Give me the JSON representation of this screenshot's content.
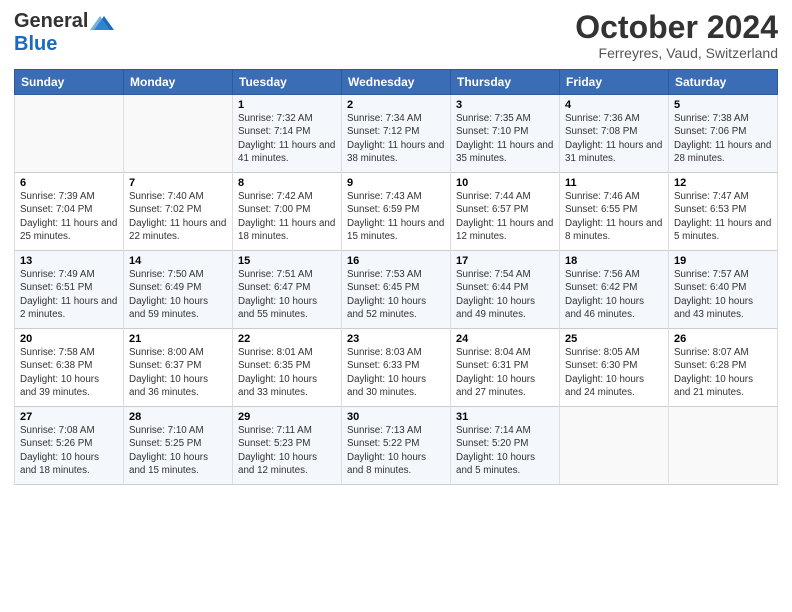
{
  "header": {
    "logo_general": "General",
    "logo_blue": "Blue",
    "month_title": "October 2024",
    "location": "Ferreyres, Vaud, Switzerland"
  },
  "weekdays": [
    "Sunday",
    "Monday",
    "Tuesday",
    "Wednesday",
    "Thursday",
    "Friday",
    "Saturday"
  ],
  "weeks": [
    [
      {
        "day": "",
        "info": ""
      },
      {
        "day": "",
        "info": ""
      },
      {
        "day": "1",
        "info": "Sunrise: 7:32 AM\nSunset: 7:14 PM\nDaylight: 11 hours and 41 minutes."
      },
      {
        "day": "2",
        "info": "Sunrise: 7:34 AM\nSunset: 7:12 PM\nDaylight: 11 hours and 38 minutes."
      },
      {
        "day": "3",
        "info": "Sunrise: 7:35 AM\nSunset: 7:10 PM\nDaylight: 11 hours and 35 minutes."
      },
      {
        "day": "4",
        "info": "Sunrise: 7:36 AM\nSunset: 7:08 PM\nDaylight: 11 hours and 31 minutes."
      },
      {
        "day": "5",
        "info": "Sunrise: 7:38 AM\nSunset: 7:06 PM\nDaylight: 11 hours and 28 minutes."
      }
    ],
    [
      {
        "day": "6",
        "info": "Sunrise: 7:39 AM\nSunset: 7:04 PM\nDaylight: 11 hours and 25 minutes."
      },
      {
        "day": "7",
        "info": "Sunrise: 7:40 AM\nSunset: 7:02 PM\nDaylight: 11 hours and 22 minutes."
      },
      {
        "day": "8",
        "info": "Sunrise: 7:42 AM\nSunset: 7:00 PM\nDaylight: 11 hours and 18 minutes."
      },
      {
        "day": "9",
        "info": "Sunrise: 7:43 AM\nSunset: 6:59 PM\nDaylight: 11 hours and 15 minutes."
      },
      {
        "day": "10",
        "info": "Sunrise: 7:44 AM\nSunset: 6:57 PM\nDaylight: 11 hours and 12 minutes."
      },
      {
        "day": "11",
        "info": "Sunrise: 7:46 AM\nSunset: 6:55 PM\nDaylight: 11 hours and 8 minutes."
      },
      {
        "day": "12",
        "info": "Sunrise: 7:47 AM\nSunset: 6:53 PM\nDaylight: 11 hours and 5 minutes."
      }
    ],
    [
      {
        "day": "13",
        "info": "Sunrise: 7:49 AM\nSunset: 6:51 PM\nDaylight: 11 hours and 2 minutes."
      },
      {
        "day": "14",
        "info": "Sunrise: 7:50 AM\nSunset: 6:49 PM\nDaylight: 10 hours and 59 minutes."
      },
      {
        "day": "15",
        "info": "Sunrise: 7:51 AM\nSunset: 6:47 PM\nDaylight: 10 hours and 55 minutes."
      },
      {
        "day": "16",
        "info": "Sunrise: 7:53 AM\nSunset: 6:45 PM\nDaylight: 10 hours and 52 minutes."
      },
      {
        "day": "17",
        "info": "Sunrise: 7:54 AM\nSunset: 6:44 PM\nDaylight: 10 hours and 49 minutes."
      },
      {
        "day": "18",
        "info": "Sunrise: 7:56 AM\nSunset: 6:42 PM\nDaylight: 10 hours and 46 minutes."
      },
      {
        "day": "19",
        "info": "Sunrise: 7:57 AM\nSunset: 6:40 PM\nDaylight: 10 hours and 43 minutes."
      }
    ],
    [
      {
        "day": "20",
        "info": "Sunrise: 7:58 AM\nSunset: 6:38 PM\nDaylight: 10 hours and 39 minutes."
      },
      {
        "day": "21",
        "info": "Sunrise: 8:00 AM\nSunset: 6:37 PM\nDaylight: 10 hours and 36 minutes."
      },
      {
        "day": "22",
        "info": "Sunrise: 8:01 AM\nSunset: 6:35 PM\nDaylight: 10 hours and 33 minutes."
      },
      {
        "day": "23",
        "info": "Sunrise: 8:03 AM\nSunset: 6:33 PM\nDaylight: 10 hours and 30 minutes."
      },
      {
        "day": "24",
        "info": "Sunrise: 8:04 AM\nSunset: 6:31 PM\nDaylight: 10 hours and 27 minutes."
      },
      {
        "day": "25",
        "info": "Sunrise: 8:05 AM\nSunset: 6:30 PM\nDaylight: 10 hours and 24 minutes."
      },
      {
        "day": "26",
        "info": "Sunrise: 8:07 AM\nSunset: 6:28 PM\nDaylight: 10 hours and 21 minutes."
      }
    ],
    [
      {
        "day": "27",
        "info": "Sunrise: 7:08 AM\nSunset: 5:26 PM\nDaylight: 10 hours and 18 minutes."
      },
      {
        "day": "28",
        "info": "Sunrise: 7:10 AM\nSunset: 5:25 PM\nDaylight: 10 hours and 15 minutes."
      },
      {
        "day": "29",
        "info": "Sunrise: 7:11 AM\nSunset: 5:23 PM\nDaylight: 10 hours and 12 minutes."
      },
      {
        "day": "30",
        "info": "Sunrise: 7:13 AM\nSunset: 5:22 PM\nDaylight: 10 hours and 8 minutes."
      },
      {
        "day": "31",
        "info": "Sunrise: 7:14 AM\nSunset: 5:20 PM\nDaylight: 10 hours and 5 minutes."
      },
      {
        "day": "",
        "info": ""
      },
      {
        "day": "",
        "info": ""
      }
    ]
  ]
}
